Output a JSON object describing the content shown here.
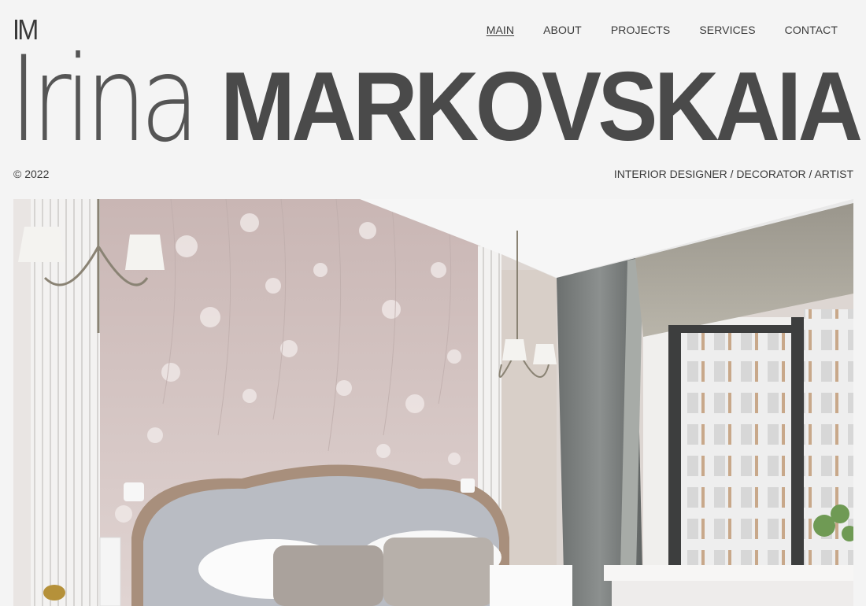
{
  "brand": {
    "logo": "IM"
  },
  "nav": {
    "items": [
      {
        "label": "MAIN",
        "active": true
      },
      {
        "label": "ABOUT",
        "active": false
      },
      {
        "label": "PROJECTS",
        "active": false
      },
      {
        "label": "SERVICES",
        "active": false
      },
      {
        "label": "CONTACT",
        "active": false
      }
    ]
  },
  "hero": {
    "first_name": "Irina",
    "last_name": "MARKOVSKAIA",
    "copyright": "© 2022",
    "roles": "INTERIOR DESIGNER / DECORATOR / ARTIST"
  },
  "photo": {
    "subject": "bedroom-interior-photo",
    "colors": {
      "wallpaper": "#d7c9c6",
      "curtain": "#7c7f7e",
      "headboard": "#b8bbc2",
      "window_frame": "#3a3b3b",
      "trim": "#f7f5f4"
    }
  }
}
